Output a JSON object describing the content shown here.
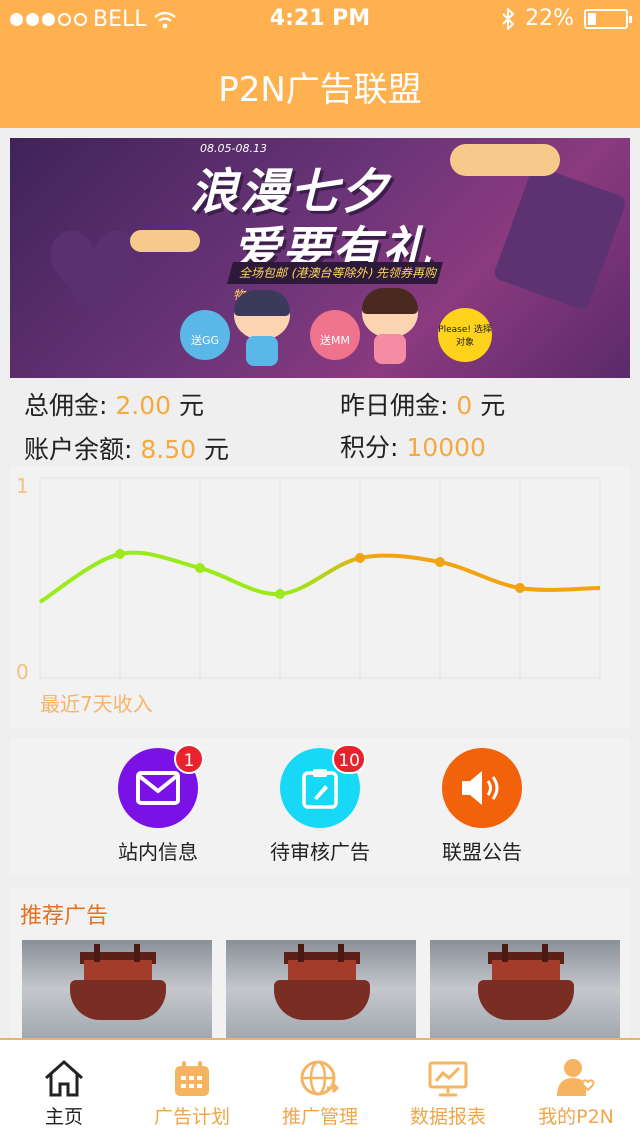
{
  "status_bar": {
    "carrier": "BELL",
    "time": "4:21 PM",
    "battery": "22%"
  },
  "header": {
    "title": "P2N广告联盟"
  },
  "banner": {
    "date_range": "08.05-08.13",
    "headline_line1": "浪漫七夕",
    "headline_line2": "爱要有礼",
    "ribbon_text": "全场包邮 (港澳台等除外)  先领券再购物",
    "badge_gg": "送GG",
    "badge_mm": "送MM",
    "badge_please": "Please! 选择对象"
  },
  "stats": {
    "total_commission_label": "总佣金:",
    "total_commission_value": "2.00",
    "total_commission_unit": "元",
    "yesterday_label": "昨日佣金:",
    "yesterday_value": "0",
    "yesterday_unit": "元",
    "balance_label": "账户余额:",
    "balance_value": "8.50",
    "balance_unit": "元",
    "points_label": "积分:",
    "points_value": "10000"
  },
  "chart_data": {
    "type": "line",
    "title": "",
    "xlabel": "",
    "ylabel": "",
    "caption": "最近7天收入",
    "ylim": [
      0,
      1
    ],
    "y_ticks": [
      "0",
      "1"
    ],
    "x": [
      1,
      2,
      3,
      4,
      5,
      6,
      7
    ],
    "series": [
      {
        "values": [
          0.62,
          0.55,
          0.42,
          0.6,
          0.58,
          0.45,
          0.45
        ]
      }
    ],
    "grid": true,
    "colors": {
      "start": "#9bea1a",
      "end": "#f2a312"
    }
  },
  "actions": [
    {
      "label": "站内信息",
      "count": "1",
      "color": "#7a12e8",
      "icon": "mail-icon"
    },
    {
      "label": "待审核广告",
      "count": "10",
      "color": "#18d8f8",
      "icon": "clipboard-icon"
    },
    {
      "label": "联盟公告",
      "color": "#f2620a",
      "icon": "speaker-icon"
    }
  ],
  "recommended": {
    "title": "推荐广告"
  },
  "tabs": [
    {
      "label": "主页",
      "icon": "home-icon",
      "active": true
    },
    {
      "label": "广告计划",
      "icon": "calendar-icon"
    },
    {
      "label": "推广管理",
      "icon": "globe-icon"
    },
    {
      "label": "数据报表",
      "icon": "chart-board-icon"
    },
    {
      "label": "我的P2N",
      "icon": "user-heart-icon"
    }
  ]
}
